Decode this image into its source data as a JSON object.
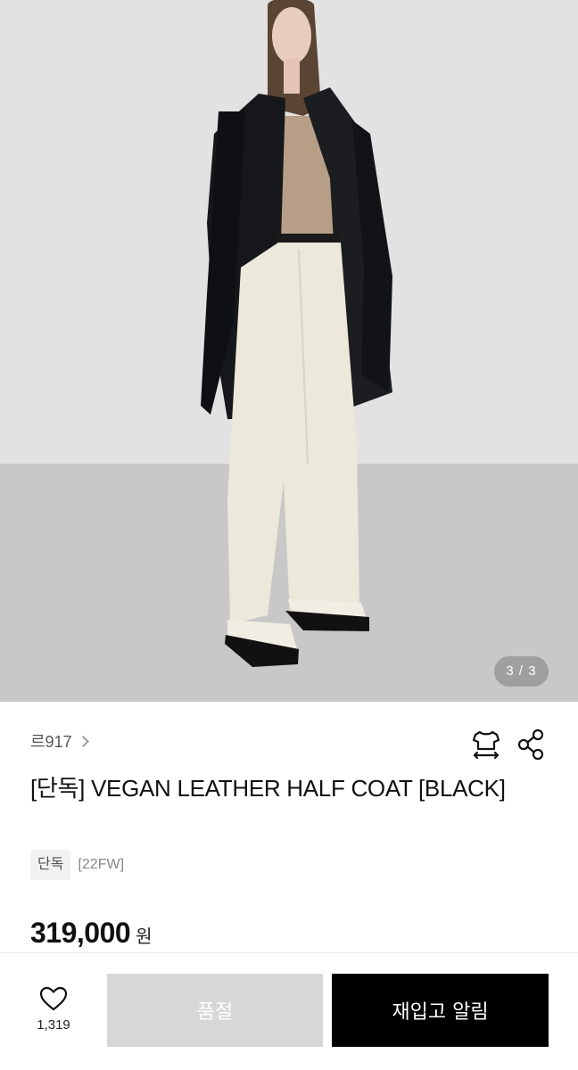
{
  "gallery": {
    "image_alt": "Model wearing black vegan leather half coat with cream trousers",
    "counter": "3 / 3"
  },
  "product": {
    "brand": "르917",
    "title": "[단독] VEGAN LEATHER HALF COAT [BLACK]",
    "tags": [
      "단독",
      "[22FW]"
    ],
    "price": "319,000",
    "currency": "원",
    "icons": {
      "size_guide": "size-guide-icon",
      "share": "share-icon",
      "brand_chevron": "chevron-right-icon"
    }
  },
  "bottom_bar": {
    "like_count": "1,319",
    "soldout_label": "품절",
    "restock_label": "재입고 알림",
    "icons": {
      "like": "heart-icon"
    }
  },
  "colors": {
    "primary": "#000000",
    "disabled": "#d7d7d7",
    "tag_bg": "#f2f2f2"
  }
}
